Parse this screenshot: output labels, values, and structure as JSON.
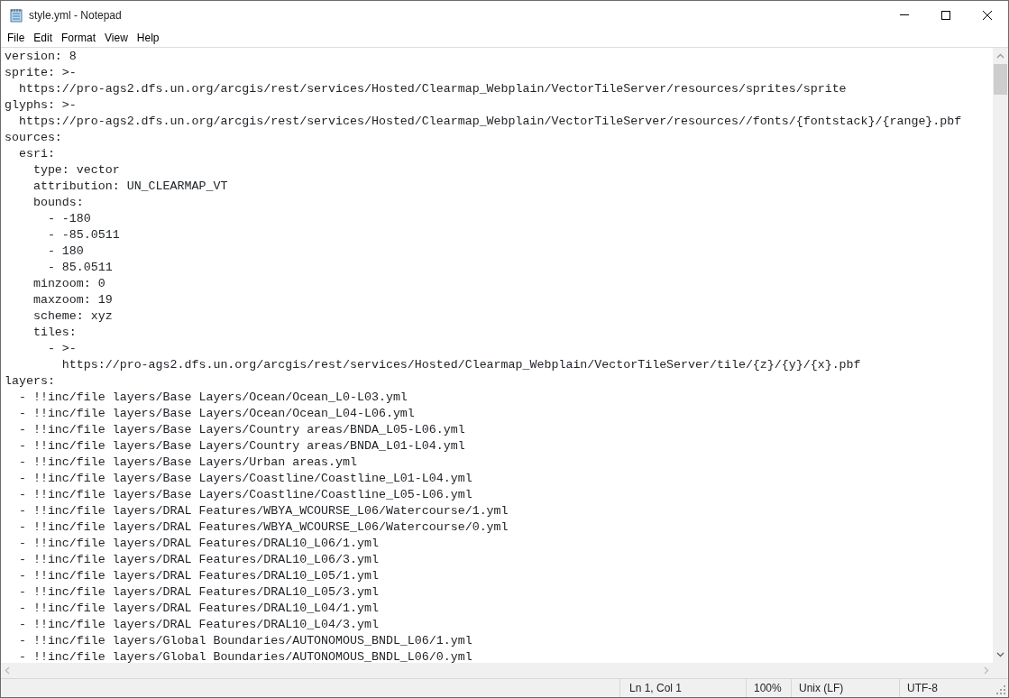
{
  "window": {
    "title": "style.yml - Notepad"
  },
  "menu": [
    "File",
    "Edit",
    "Format",
    "View",
    "Help"
  ],
  "editor": {
    "lines": [
      "version: 8",
      "sprite: >-",
      "  https://pro-ags2.dfs.un.org/arcgis/rest/services/Hosted/Clearmap_Webplain/VectorTileServer/resources/sprites/sprite",
      "glyphs: >-",
      "  https://pro-ags2.dfs.un.org/arcgis/rest/services/Hosted/Clearmap_Webplain/VectorTileServer/resources//fonts/{fontstack}/{range}.pbf",
      "sources:",
      "  esri:",
      "    type: vector",
      "    attribution: UN_CLEARMAP_VT",
      "    bounds:",
      "      - -180",
      "      - -85.0511",
      "      - 180",
      "      - 85.0511",
      "    minzoom: 0",
      "    maxzoom: 19",
      "    scheme: xyz",
      "    tiles:",
      "      - >-",
      "        https://pro-ags2.dfs.un.org/arcgis/rest/services/Hosted/Clearmap_Webplain/VectorTileServer/tile/{z}/{y}/{x}.pbf",
      "layers:",
      "  - !!inc/file layers/Base Layers/Ocean/Ocean_L0-L03.yml",
      "  - !!inc/file layers/Base Layers/Ocean/Ocean_L04-L06.yml",
      "  - !!inc/file layers/Base Layers/Country areas/BNDA_L05-L06.yml",
      "  - !!inc/file layers/Base Layers/Country areas/BNDA_L01-L04.yml",
      "  - !!inc/file layers/Base Layers/Urban areas.yml",
      "  - !!inc/file layers/Base Layers/Coastline/Coastline_L01-L04.yml",
      "  - !!inc/file layers/Base Layers/Coastline/Coastline_L05-L06.yml",
      "  - !!inc/file layers/DRAL Features/WBYA_WCOURSE_L06/Watercourse/1.yml",
      "  - !!inc/file layers/DRAL Features/WBYA_WCOURSE_L06/Watercourse/0.yml",
      "  - !!inc/file layers/DRAL Features/DRAL10_L06/1.yml",
      "  - !!inc/file layers/DRAL Features/DRAL10_L06/3.yml",
      "  - !!inc/file layers/DRAL Features/DRAL10_L05/1.yml",
      "  - !!inc/file layers/DRAL Features/DRAL10_L05/3.yml",
      "  - !!inc/file layers/DRAL Features/DRAL10_L04/1.yml",
      "  - !!inc/file layers/DRAL Features/DRAL10_L04/3.yml",
      "  - !!inc/file layers/Global Boundaries/AUTONOMOUS_BNDL_L06/1.yml",
      "  - !!inc/file layers/Global Boundaries/AUTONOMOUS_BNDL_L06/0.yml"
    ]
  },
  "status_bar": {
    "position": "Ln 1, Col 1",
    "zoom": "100%",
    "line_ending": "Unix (LF)",
    "encoding": "UTF-8"
  }
}
